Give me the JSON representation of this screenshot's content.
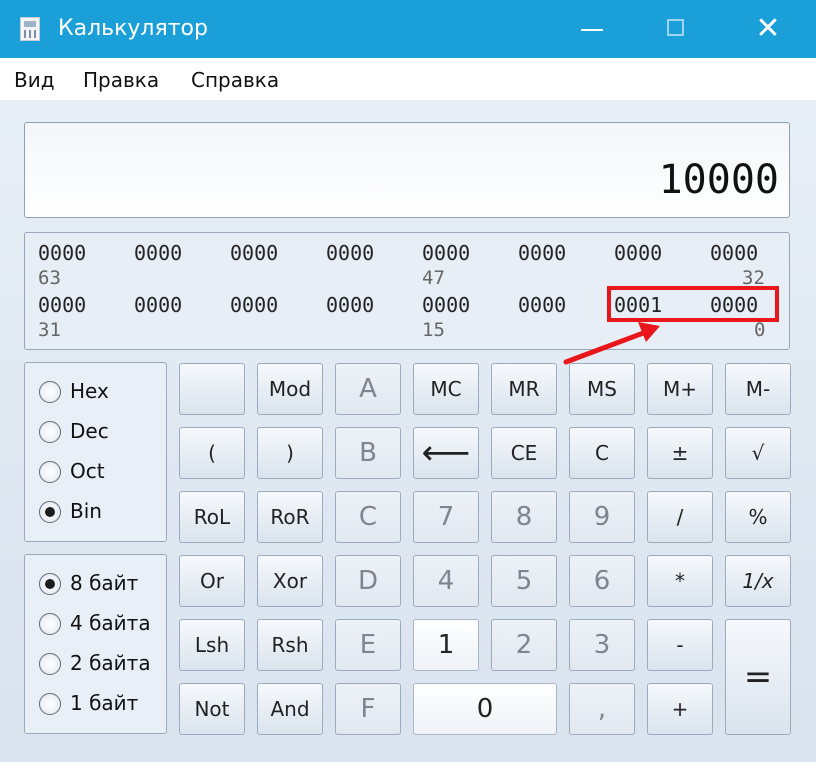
{
  "window": {
    "title": "Калькулятор",
    "icon": "calculator-icon",
    "close_glyph": "✕"
  },
  "menu": [
    "Вид",
    "Правка",
    "Справка"
  ],
  "display": {
    "value": "10000"
  },
  "bits": {
    "row1": [
      "0000",
      "0000",
      "0000",
      "0000",
      "0000",
      "0000",
      "0000",
      "0000"
    ],
    "row1_positions": [
      "63",
      "47",
      "32"
    ],
    "row2": [
      "0000",
      "0000",
      "0000",
      "0000",
      "0000",
      "0000",
      "0001",
      "0000"
    ],
    "row2_positions": [
      "31",
      "15",
      "0"
    ]
  },
  "annotation": {
    "color": "#e8151a"
  },
  "radix": {
    "options": [
      "Hex",
      "Dec",
      "Oct",
      "Bin"
    ],
    "selected": "Bin"
  },
  "word_size": {
    "options": [
      "8 байт",
      "4 байта",
      "2 байта",
      "1 байт"
    ],
    "selected": "8 байт"
  },
  "keys": {
    "row1": [
      "",
      "Mod",
      "A",
      "MC",
      "MR",
      "MS",
      "M+",
      "M-"
    ],
    "row2": [
      "(",
      ")",
      "B",
      "⟵",
      "CE",
      "C",
      "±",
      "√"
    ],
    "row3": [
      "RoL",
      "RoR",
      "C",
      "7",
      "8",
      "9",
      "/",
      "%"
    ],
    "row4": [
      "Or",
      "Xor",
      "D",
      "4",
      "5",
      "6",
      "*",
      "1/x"
    ],
    "row5": [
      "Lsh",
      "Rsh",
      "E",
      "1",
      "2",
      "3",
      "-"
    ],
    "row6": [
      "Not",
      "And",
      "F",
      "0",
      ",",
      "+"
    ],
    "equals": "="
  },
  "colors": {
    "titlebar": "#1b9fd8",
    "background": "#dfe8f2"
  }
}
